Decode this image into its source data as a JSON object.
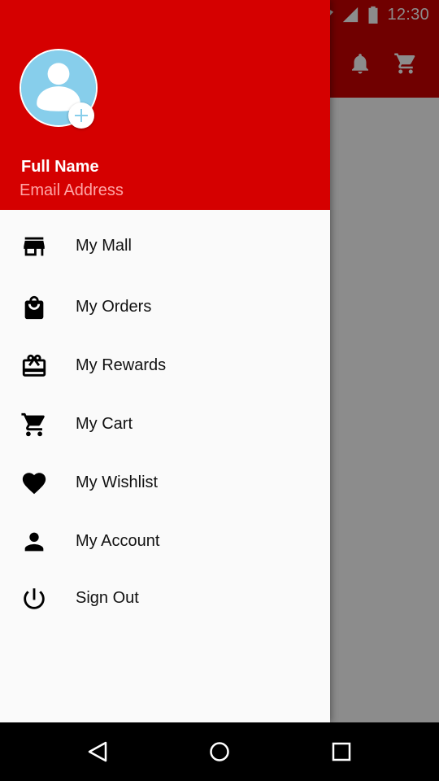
{
  "status_bar": {
    "time": "12:30",
    "icons": [
      "wifi-icon",
      "signal-icon",
      "battery-icon"
    ]
  },
  "app_bar": {
    "actions": [
      "bell-icon",
      "cart-icon"
    ]
  },
  "drawer": {
    "header": {
      "full_name": "Full Name",
      "email": "Email Address",
      "avatar_icon": "avatar-placeholder-icon",
      "add_icon": "add-circle-icon"
    },
    "items": [
      {
        "label": "My Mall",
        "icon": "store-icon"
      },
      {
        "label": "My Orders",
        "icon": "shopping-bag-icon"
      },
      {
        "label": "My Rewards",
        "icon": "gift-card-icon"
      },
      {
        "label": "My Cart",
        "icon": "cart-icon"
      },
      {
        "label": "My Wishlist",
        "icon": "heart-icon"
      },
      {
        "label": "My Account",
        "icon": "person-icon"
      },
      {
        "label": "Sign Out",
        "icon": "power-icon"
      }
    ]
  },
  "nav_bar": {
    "buttons": [
      "back-icon",
      "home-icon",
      "recents-icon"
    ]
  },
  "colors": {
    "primary": "#d50000",
    "email_text": "#ffa5a5",
    "avatar_bg": "#87ceeb",
    "drawer_bg": "#fafafa",
    "scrim": "#8f8f8f"
  }
}
